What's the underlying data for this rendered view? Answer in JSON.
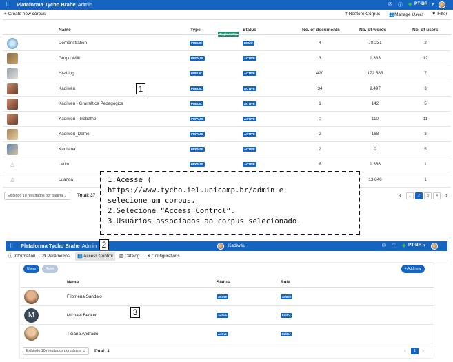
{
  "top": {
    "app_title": "Plataforma Tycho Brahe",
    "app_subtitle": "Admin",
    "lang": "PT-BR",
    "create_label": "Create new corpus",
    "restore_label": "Restore Corpus",
    "manage_users_label": "Manage Users",
    "filter_label": "Filter",
    "tooltip": "Toggle SortBy",
    "headers": {
      "name": "Name",
      "type": "Type",
      "status": "Status",
      "docs": "No. of documents",
      "words": "No. of words",
      "users": "No. of users"
    },
    "rows": [
      {
        "name": "Demonstration",
        "type": "PUBLIC",
        "status": "DEMO",
        "docs": "4",
        "words": "78.231",
        "users": "2"
      },
      {
        "name": "Grupo Willi",
        "type": "PRIVATE",
        "status": "ACTIVE",
        "docs": "3",
        "words": "1.333",
        "users": "12"
      },
      {
        "name": "HistLing",
        "type": "PUBLIC",
        "status": "ACTIVE",
        "docs": "420",
        "words": "172.585",
        "users": "7"
      },
      {
        "name": "Kadiwéu",
        "type": "PUBLIC",
        "status": "ACTIVE",
        "docs": "34",
        "words": "9.497",
        "users": "3"
      },
      {
        "name": "Kadiweu - Gramática Pedagógica",
        "type": "PUBLIC",
        "status": "ACTIVE",
        "docs": "1",
        "words": "142",
        "users": "5"
      },
      {
        "name": "Kadiweu - Trabalho",
        "type": "PRIVATE",
        "status": "ACTIVE",
        "docs": "0",
        "words": "110",
        "users": "11"
      },
      {
        "name": "Kadiwéu_Demo",
        "type": "PRIVATE",
        "status": "ACTIVE",
        "docs": "2",
        "words": "168",
        "users": "3"
      },
      {
        "name": "Kariliana",
        "type": "PRIVATE",
        "status": "ACTIVE",
        "docs": "2",
        "words": "0",
        "users": "5"
      },
      {
        "name": "Latim",
        "type": "PRIVATE",
        "status": "ACTIVE",
        "docs": "6",
        "words": "1.386",
        "users": "1"
      },
      {
        "name": "Luanda",
        "type": "",
        "status": "",
        "docs": "",
        "words": "13.846",
        "users": "1"
      }
    ],
    "page_size_label": "Exibindo 10 resultados por página",
    "total_label": "Total: 37",
    "pages": [
      "1",
      "2",
      "3",
      "4"
    ],
    "current_page": "2"
  },
  "callout": {
    "line1": "1.Acesse (",
    "line2": "https://www.tycho.iel.unicamp.br/admin e",
    "line3": "selecione um corpus.",
    "line4": "2.Selecione “Access Control”.",
    "line5": "3.Usuários associados ao corpus selecionado."
  },
  "markers": {
    "m1": "1",
    "m2": "2",
    "m3": "3"
  },
  "bottom": {
    "app_title": "Plataforma Tycho Brahe",
    "app_subtitle": "Admin",
    "corpus_name": "Kadiwéu",
    "lang": "PT-BR",
    "tabs": [
      "Information",
      "Parâmetros",
      "Access Control",
      "Catalog",
      "Configurations"
    ],
    "pill_users": "Users",
    "pill_roles": "Roles",
    "add_new_label": "+ Add new",
    "headers": {
      "name": "Name",
      "status": "Status",
      "role": "Role"
    },
    "users": [
      {
        "name": "Filomena Sandalo",
        "status": "Active",
        "role": "Admin",
        "initial": ""
      },
      {
        "name": "Michael Becker",
        "status": "Active",
        "role": "Editor",
        "initial": "M"
      },
      {
        "name": "Ticiana Andrade",
        "status": "Active",
        "role": "Editor",
        "initial": ""
      }
    ],
    "page_size_label": "Exibindo 10 resultados por página",
    "total_label": "Total: 3",
    "current_page": "1"
  },
  "colors": {
    "primary": "#1565c0",
    "tooltip": "#1e8a6e"
  },
  "icons": [
    "grid-icon",
    "mail-icon",
    "info-icon",
    "flag-icon",
    "plus-icon",
    "upload-icon",
    "users-icon",
    "filter-icon",
    "chevron-left-icon",
    "chevron-right-icon",
    "chevron-down-icon"
  ]
}
